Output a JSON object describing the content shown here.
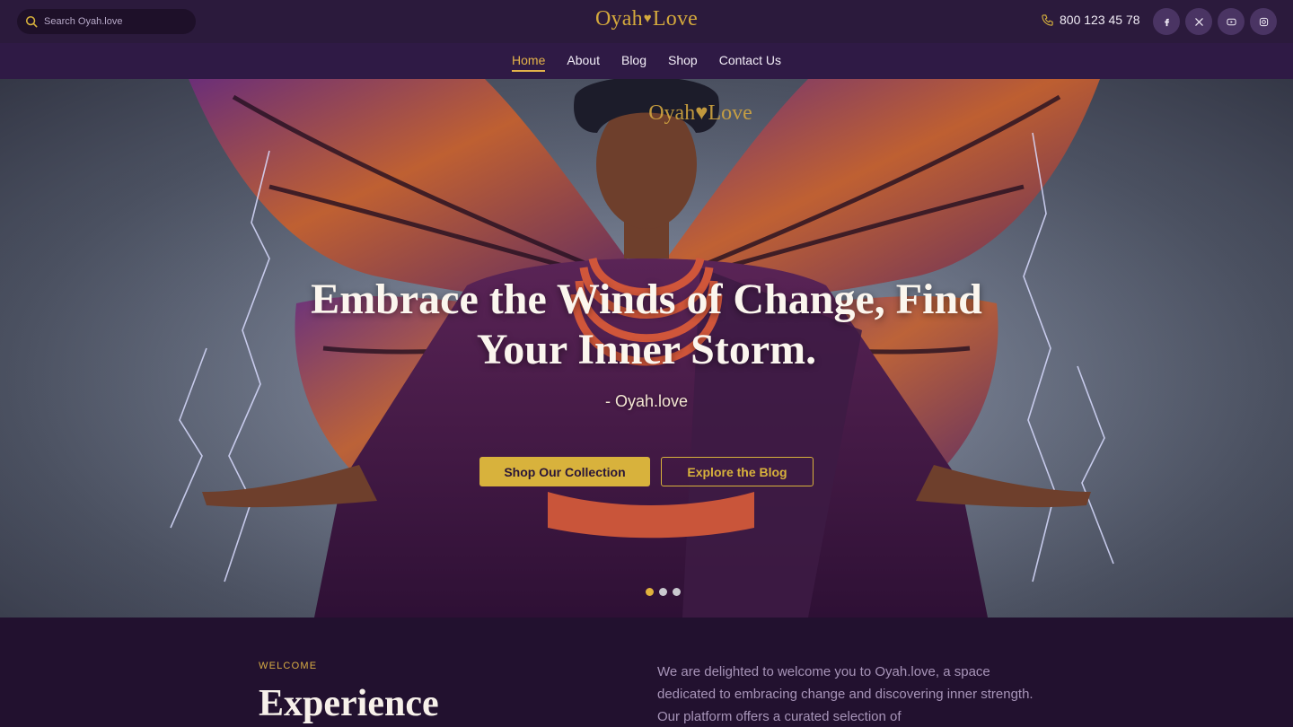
{
  "search": {
    "placeholder": "Search Oyah.love"
  },
  "brand": {
    "name_left": "Oyah",
    "heart": "♥",
    "name_right": "Love"
  },
  "contact": {
    "phone": "800 123 45 78"
  },
  "social": [
    {
      "name": "facebook",
      "icon": "facebook-icon"
    },
    {
      "name": "x",
      "icon": "x-icon"
    },
    {
      "name": "youtube",
      "icon": "youtube-icon"
    },
    {
      "name": "instagram",
      "icon": "instagram-icon"
    }
  ],
  "nav": {
    "items": [
      "Home",
      "About",
      "Blog",
      "Shop",
      "Contact Us"
    ],
    "active": "Home"
  },
  "hero": {
    "logo_left": "Oyah",
    "logo_heart": "♥",
    "logo_right": "Love",
    "title_line1": "Embrace the Winds of Change, Find",
    "title_line2": "Your Inner Storm.",
    "subtitle": "- Oyah.love",
    "primary_button": "Shop Our Collection",
    "secondary_button": "Explore the Blog",
    "slides": 3,
    "active_slide": 1
  },
  "welcome": {
    "eyebrow": "WELCOME",
    "title": "Experience",
    "text": "We are delighted to welcome you to Oyah.love, a space dedicated to embracing change and discovering inner strength. Our platform offers a curated selection of"
  },
  "colors": {
    "accent": "#d8b23c",
    "background": "#22112f",
    "nav": "#2f1a45",
    "topbar": "#2b1a3c"
  }
}
